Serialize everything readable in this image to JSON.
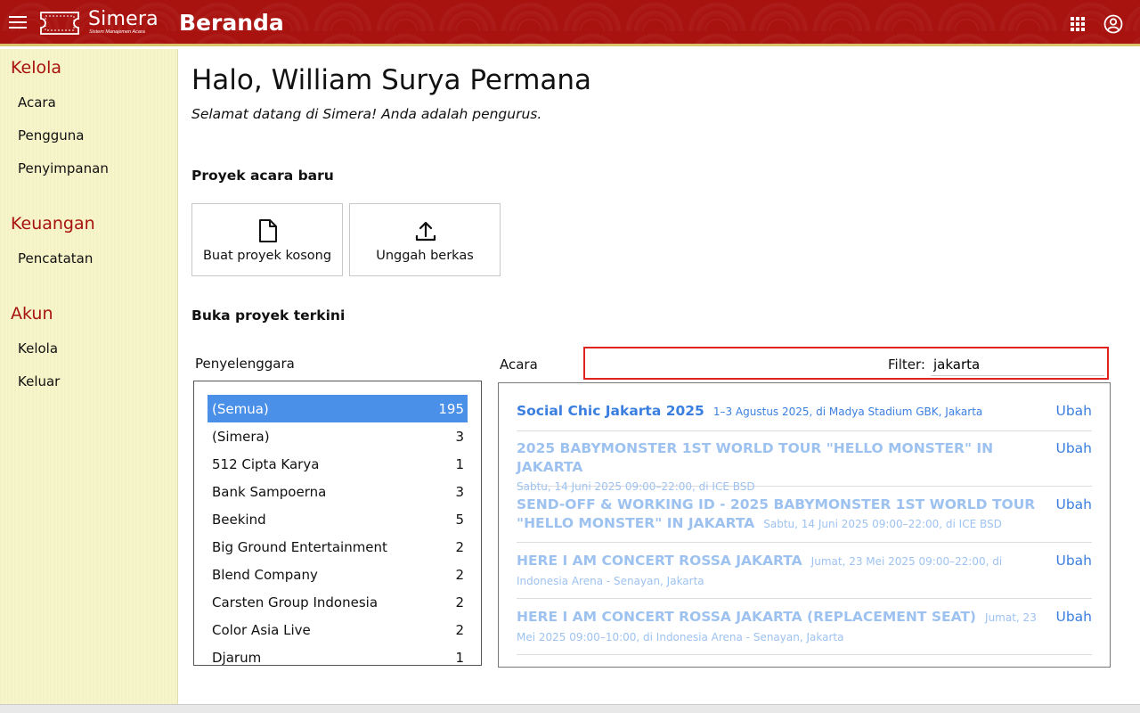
{
  "header": {
    "app_name": "Simera",
    "app_tagline": "Sistem Manajemen Acara",
    "page_title": "Beranda",
    "brand_color": "#a8120f"
  },
  "sidebar": {
    "sections": [
      {
        "title": "Kelola",
        "items": [
          "Acara",
          "Pengguna",
          "Penyimpanan"
        ]
      },
      {
        "title": "Keuangan",
        "items": [
          "Pencatatan"
        ]
      },
      {
        "title": "Akun",
        "items": [
          "Kelola",
          "Keluar"
        ]
      }
    ]
  },
  "main": {
    "greeting": "Halo, William Surya Permana",
    "welcome": "Selamat datang di Simera! Anda adalah pengurus.",
    "new_project_title": "Proyek acara baru",
    "new_buttons": [
      {
        "label": "Buat proyek kosong",
        "icon": "file-icon"
      },
      {
        "label": "Unggah berkas",
        "icon": "upload-icon"
      }
    ],
    "recent_title": "Buka proyek terkini",
    "organizer_label": "Penyelenggara",
    "events_label": "Acara",
    "filter_label": "Filter:",
    "filter_value": "jakarta"
  },
  "organizers": [
    {
      "name": "(Semua)",
      "count": "195",
      "selected": true
    },
    {
      "name": "(Simera)",
      "count": "3"
    },
    {
      "name": "512 Cipta Karya",
      "count": "1"
    },
    {
      "name": "Bank Sampoerna",
      "count": "3"
    },
    {
      "name": "Beekind",
      "count": "5"
    },
    {
      "name": "Big Ground Entertainment",
      "count": "2"
    },
    {
      "name": "Blend Company",
      "count": "2"
    },
    {
      "name": "Carsten Group Indonesia",
      "count": "2"
    },
    {
      "name": "Color Asia Live",
      "count": "2"
    },
    {
      "name": "Djarum",
      "count": "1"
    }
  ],
  "events": [
    {
      "title": "Social Chic Jakarta 2025",
      "meta": "1–3 Agustus 2025, di Madya Stadium GBK, Jakarta",
      "edit": "Ubah",
      "state": "active"
    },
    {
      "title": "2025 BABYMONSTER 1ST WORLD TOUR \"HELLO MONSTER\" IN JAKARTA",
      "meta": "Sabtu, 14 Juni 2025 09:00–22:00, di ICE BSD",
      "edit": "Ubah",
      "state": "past"
    },
    {
      "title": "SEND-OFF & WORKING ID - 2025 BABYMONSTER 1ST WORLD TOUR \"HELLO MONSTER\" IN JAKARTA",
      "meta": "Sabtu, 14 Juni 2025 09:00–22:00, di ICE BSD",
      "edit": "Ubah",
      "state": "past"
    },
    {
      "title": "HERE I AM CONCERT ROSSA JAKARTA",
      "meta": "Jumat, 23 Mei 2025 09:00–22:00, di Indonesia Arena - Senayan, Jakarta",
      "edit": "Ubah",
      "state": "past"
    },
    {
      "title": "HERE I AM CONCERT ROSSA JAKARTA (REPLACEMENT SEAT)",
      "meta": "Jumat, 23 Mei 2025 09:00–10:00, di Indonesia Arena - Senayan, Jakarta",
      "edit": "Ubah",
      "state": "past"
    }
  ]
}
